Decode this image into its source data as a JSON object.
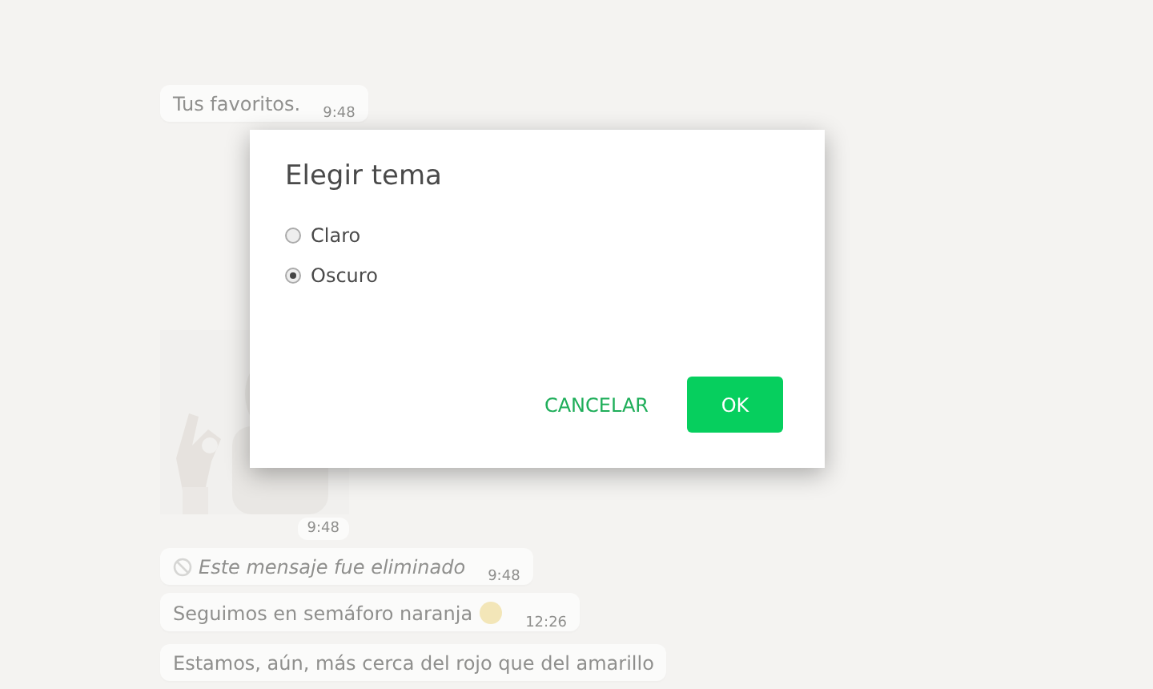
{
  "chat": {
    "messages": [
      {
        "kind": "text",
        "text": "Tus favoritos.",
        "time": "9:48"
      },
      {
        "kind": "sticker",
        "time": "9:48"
      },
      {
        "kind": "deleted",
        "text": "Este mensaje fue eliminado",
        "time": "9:48"
      },
      {
        "kind": "text",
        "text": "Seguimos en semáforo naranja",
        "emoji": true,
        "time": "12:26"
      },
      {
        "kind": "text",
        "text": "Estamos, aún, más cerca del rojo que del amarillo"
      }
    ]
  },
  "dialog": {
    "title": "Elegir tema",
    "options": [
      {
        "label": "Claro",
        "selected": false
      },
      {
        "label": "Oscuro",
        "selected": true
      }
    ],
    "buttons": [
      {
        "label": "CANCELAR",
        "kind": "text"
      },
      {
        "label": "OK",
        "kind": "primary"
      }
    ]
  }
}
